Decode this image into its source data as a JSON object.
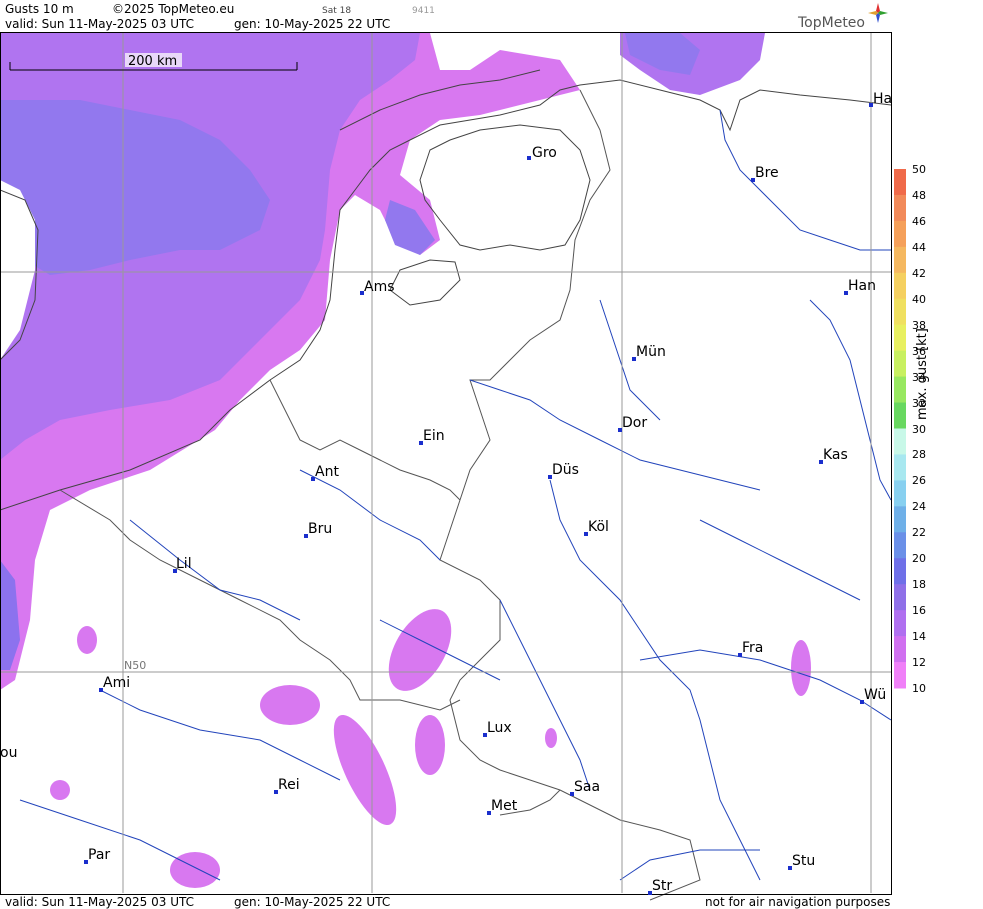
{
  "header": {
    "product": "Gusts 10 m",
    "copyright": "©2025 TopMeteo.eu",
    "sat": "Sat 18",
    "code": "9411",
    "valid": "valid:  Sun  11-May-2025  03 UTC",
    "gen": "gen: 10-May-2025 22 UTC",
    "brand": "TopMeteo"
  },
  "footer": {
    "valid": "valid:  Sun  11-May-2025  03 UTC",
    "gen": "gen: 10-May-2025 22 UTC",
    "note": "not for air navigation purposes"
  },
  "map": {
    "scale_label": "200 km",
    "grid_label": "N50",
    "cities": [
      {
        "name": "Gro"
      },
      {
        "name": "Bre"
      },
      {
        "name": "Ha"
      },
      {
        "name": "Ams"
      },
      {
        "name": "Han"
      },
      {
        "name": "Mün"
      },
      {
        "name": "Dor"
      },
      {
        "name": "Ein"
      },
      {
        "name": "Kas"
      },
      {
        "name": "Düs"
      },
      {
        "name": "Ant"
      },
      {
        "name": "Köl"
      },
      {
        "name": "Bru"
      },
      {
        "name": "Lil"
      },
      {
        "name": "Fra"
      },
      {
        "name": "Ami"
      },
      {
        "name": "Wü"
      },
      {
        "name": "Lux"
      },
      {
        "name": "ou"
      },
      {
        "name": "Rei"
      },
      {
        "name": "Saa"
      },
      {
        "name": "Met"
      },
      {
        "name": "Par"
      },
      {
        "name": "Stu"
      },
      {
        "name": "Str"
      }
    ]
  },
  "legend": {
    "title": "max. gust [kt]",
    "labels": [
      "50",
      "48",
      "46",
      "44",
      "42",
      "40",
      "38",
      "36",
      "34",
      "32",
      "30",
      "28",
      "26",
      "24",
      "22",
      "20",
      "18",
      "16",
      "14",
      "12",
      "10"
    ],
    "colors": [
      "#f06a4a",
      "#f28a5a",
      "#f5a05a",
      "#f5b860",
      "#f5d060",
      "#f0e060",
      "#e8f060",
      "#c8f060",
      "#98e860",
      "#68d860",
      "#c8f8e8",
      "#a8e8f0",
      "#88d0f0",
      "#6fb0e8",
      "#6b90e8",
      "#6f70e8",
      "#8f70e8",
      "#b070f0",
      "#d070f0",
      "#f080f8"
    ]
  }
}
